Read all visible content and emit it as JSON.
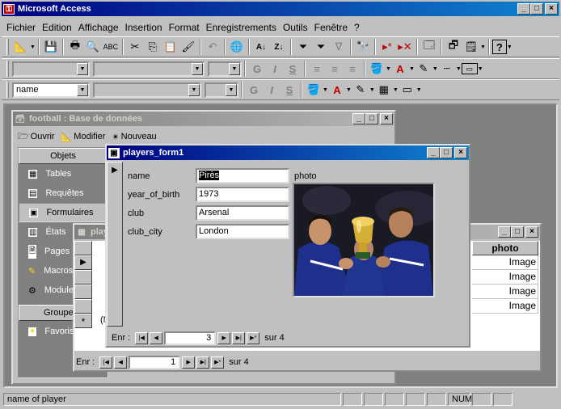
{
  "app": {
    "title": "Microsoft Access"
  },
  "menu": [
    "Fichier",
    "Edition",
    "Affichage",
    "Insertion",
    "Format",
    "Enregistrements",
    "Outils",
    "Fenêtre",
    "?"
  ],
  "format_toolbar": {
    "font_name": "name",
    "bold": "G",
    "italic": "I",
    "underline": "S"
  },
  "db_window": {
    "title": "football : Base de données",
    "open_label": "Ouvrir",
    "modify_label": "Modifier",
    "new_label": "Nouveau",
    "objects_header": "Objets",
    "items": [
      "Tables",
      "Requêtes",
      "Formulaires",
      "États",
      "Pages",
      "Macros",
      "Modules"
    ],
    "groups_header": "Groupes",
    "favorites": "Favoris"
  },
  "table_window": {
    "title": "players : Table",
    "photo_col": "photo",
    "photo_values": [
      "Image",
      "Image",
      "Image",
      "Image"
    ],
    "nav_label": "Enr :",
    "nav_current": "1",
    "nav_total": "sur  4",
    "new_row_marker": "(N"
  },
  "form_window": {
    "title": "players_form1",
    "fields": [
      {
        "label": "name",
        "value": "Pirès"
      },
      {
        "label": "year_of_birth",
        "value": "1973"
      },
      {
        "label": "club",
        "value": "Arsenal"
      },
      {
        "label": "club_city",
        "value": "London"
      }
    ],
    "photo_label": "photo",
    "nav_label": "Enr :",
    "nav_current": "3",
    "nav_total": "sur  4"
  },
  "status": {
    "text": "name of player",
    "num": "NUM"
  }
}
